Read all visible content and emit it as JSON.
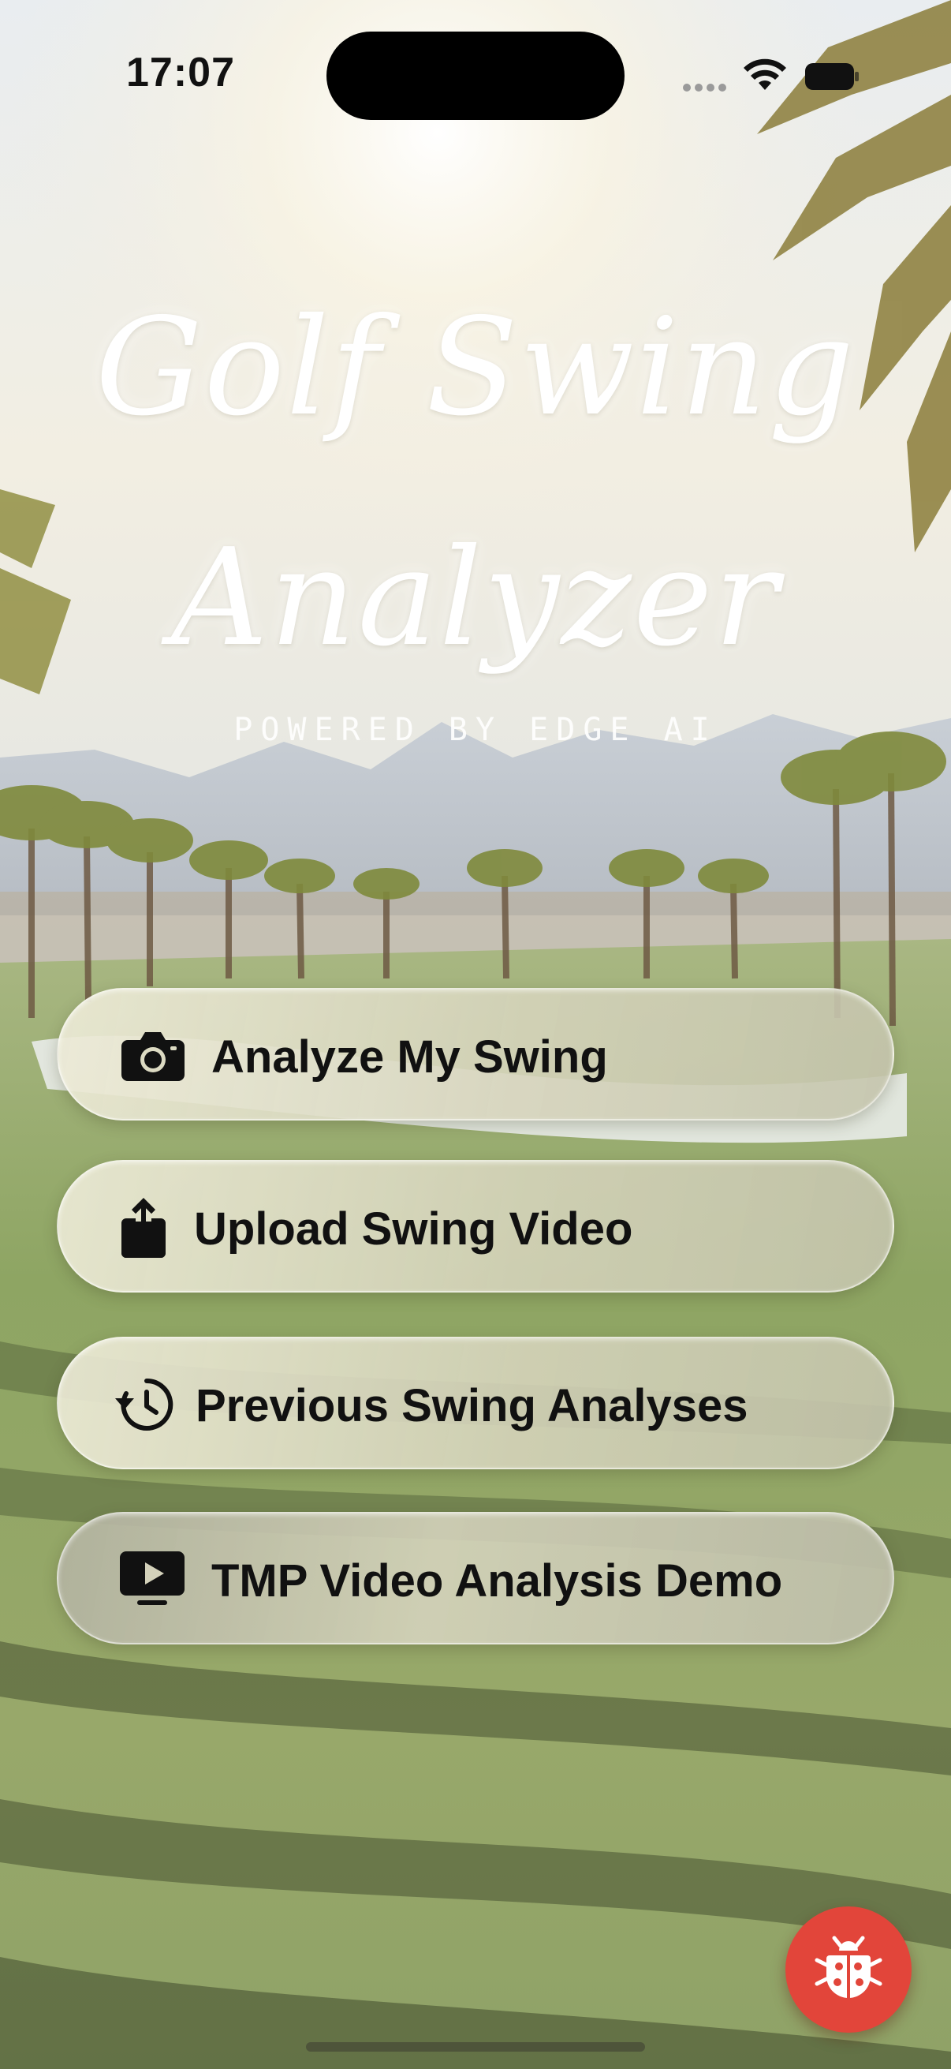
{
  "status_bar": {
    "time": "17:07",
    "icons": [
      "signal-dots-icon",
      "wifi-icon",
      "battery-icon"
    ]
  },
  "header": {
    "title_line1": "Golf Swing",
    "title_line2": "Analyzer",
    "subtitle": "POWERED BY EDGE AI"
  },
  "menu": {
    "analyze": {
      "label": "Analyze My Swing",
      "icon": "camera-icon"
    },
    "upload": {
      "label": "Upload Swing Video",
      "icon": "share-upload-icon"
    },
    "history": {
      "label": "Previous Swing Analyses",
      "icon": "clock-history-icon"
    },
    "demo": {
      "label": "TMP Video Analysis Demo",
      "icon": "play-rectangle-icon"
    }
  },
  "debug_button": {
    "icon": "ladybug-icon"
  },
  "colors": {
    "button_fill": "#dcdac2",
    "text": "#111111",
    "debug_red": "#e2453a"
  }
}
